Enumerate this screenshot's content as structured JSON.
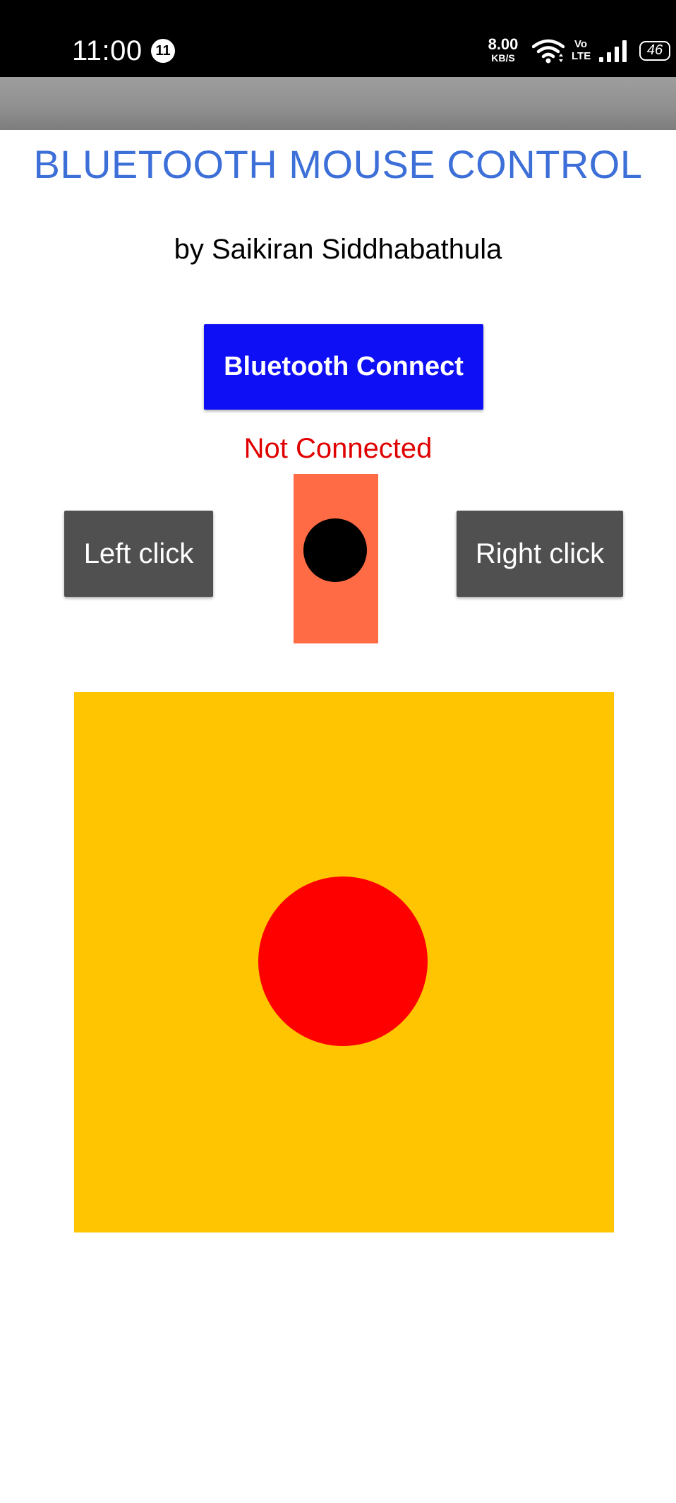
{
  "status_bar": {
    "time": "11:00",
    "notification_count": "11",
    "net_speed_value": "8.00",
    "net_speed_unit": "KB/S",
    "volte_top": "Vo",
    "volte_bottom": "LTE",
    "battery_level": "46",
    "icons": [
      "wifi-icon",
      "volte-icon",
      "signal-icon",
      "battery-icon"
    ]
  },
  "header": {
    "title": "BLUETOOTH MOUSE CONTROL",
    "author": "by Saikiran Siddhabathula"
  },
  "connect": {
    "button_label": "Bluetooth Connect",
    "status_text": "Not Connected"
  },
  "controls": {
    "left_click_label": "Left click",
    "right_click_label": "Right click"
  },
  "colors": {
    "title": "#3d6fd8",
    "connect_button": "#0f0ff5",
    "status_text": "#e00000",
    "click_buttons": "#505050",
    "scroll_track": "#ff6b45",
    "scroll_knob": "#000000",
    "touchpad": "#ffc500",
    "touch_knob": "#ff0000"
  }
}
